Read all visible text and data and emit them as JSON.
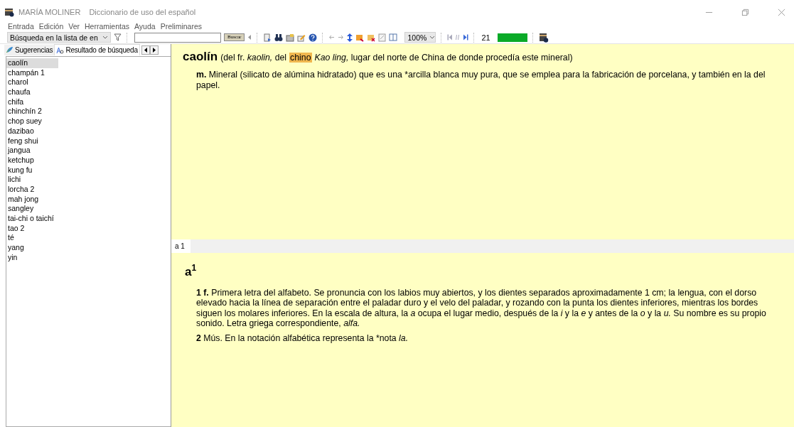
{
  "window": {
    "app_name": "MARÍA MOLINER",
    "title": "Diccionario de uso del español"
  },
  "menu": [
    "Entrada",
    "Edición",
    "Ver",
    "Herramientas",
    "Ayuda",
    "Preliminares"
  ],
  "toolbar": {
    "search_mode": "Búsqueda en la lista de en",
    "search_button": "Buscar",
    "zoom": "100%",
    "page": "21",
    "progress": {
      "level": 1
    }
  },
  "sidebar": {
    "tabs": [
      {
        "label": "Sugerencias",
        "selected": false
      },
      {
        "label": "Resultado de búsqueda",
        "selected": true
      }
    ],
    "items": [
      {
        "label": "caolín",
        "selected": true
      },
      {
        "label": "champán 1",
        "selected": false
      },
      {
        "label": "charol",
        "selected": false
      },
      {
        "label": "chaufa",
        "selected": false
      },
      {
        "label": "chifa",
        "selected": false
      },
      {
        "label": "chinchín 2",
        "selected": false
      },
      {
        "label": "chop suey",
        "selected": false
      },
      {
        "label": "dazibao",
        "selected": false
      },
      {
        "label": "feng shui",
        "selected": false
      },
      {
        "label": "jangua",
        "selected": false
      },
      {
        "label": "ketchup",
        "selected": false
      },
      {
        "label": "kung fu",
        "selected": false
      },
      {
        "label": "lichi",
        "selected": false
      },
      {
        "label": "lorcha 2",
        "selected": false
      },
      {
        "label": "mah jong",
        "selected": false
      },
      {
        "label": "sangley",
        "selected": false
      },
      {
        "label": "tai-chi o taichí",
        "selected": false
      },
      {
        "label": "tao 2",
        "selected": false
      },
      {
        "label": "té",
        "selected": false
      },
      {
        "label": "yang",
        "selected": false
      },
      {
        "label": "yin",
        "selected": false
      }
    ]
  },
  "entry": {
    "headword": "caolín",
    "etymology": [
      {
        "kind": "text",
        "text": "(del fr. *kaolin,* del"
      },
      {
        "kind": "highlight",
        "text": "chino"
      },
      {
        "kind": "text",
        "text": "*Kao ling,* lugar del norte de China de donde procedía este mineral)"
      }
    ],
    "senses": [
      "**m.** Mineral (silicato de alúmina hidratado) que es una *arcilla blanca muy pura, que se emplea para la fabricación de porcelana, y también en la del papel."
    ]
  },
  "lower_tabs": [
    {
      "label": "a 1",
      "selected": true
    }
  ],
  "lower_entry": {
    "headword": "a$^{1}$",
    "senses": [
      "**1 f.** Primera letra del alfabeto. Se pronuncia con los labios muy abiertos, y los dientes separados aproximadamente 1 cm; la lengua, con el dorso elevado hacia la línea de separación entre el paladar duro y el velo del paladar, y rozando con la punta los dientes inferiores, mientras los bordes siguen los molares inferiores. En la escala de altura, la *a* ocupa el lugar medio, después de la *i* y la *e* y antes de la *o* y la *u.* Su nombre es su propio sonido. Letra griega correspondiente, *alfa.*",
      "**2** Mús. En la notación alfabética representa la *nota *la.*"
    ]
  }
}
